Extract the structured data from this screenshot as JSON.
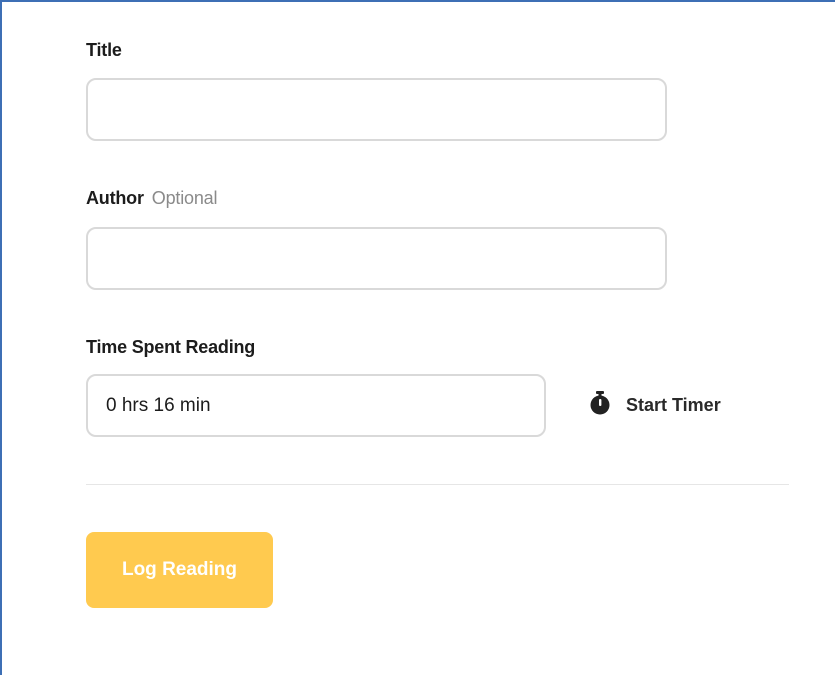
{
  "form": {
    "title": {
      "label": "Title",
      "value": "",
      "placeholder": ""
    },
    "author": {
      "label": "Author",
      "optional_label": "Optional",
      "value": "",
      "placeholder": ""
    },
    "time_spent": {
      "label": "Time Spent Reading",
      "value": "0 hrs 16 min"
    },
    "timer": {
      "label": "Start Timer",
      "icon": "stopwatch-icon"
    },
    "submit_label": "Log Reading"
  },
  "colors": {
    "frame_border": "#3d6fb5",
    "button_bg": "#ffca4f",
    "input_border": "#d9d9d9",
    "optional_text": "#8a8a8a"
  }
}
